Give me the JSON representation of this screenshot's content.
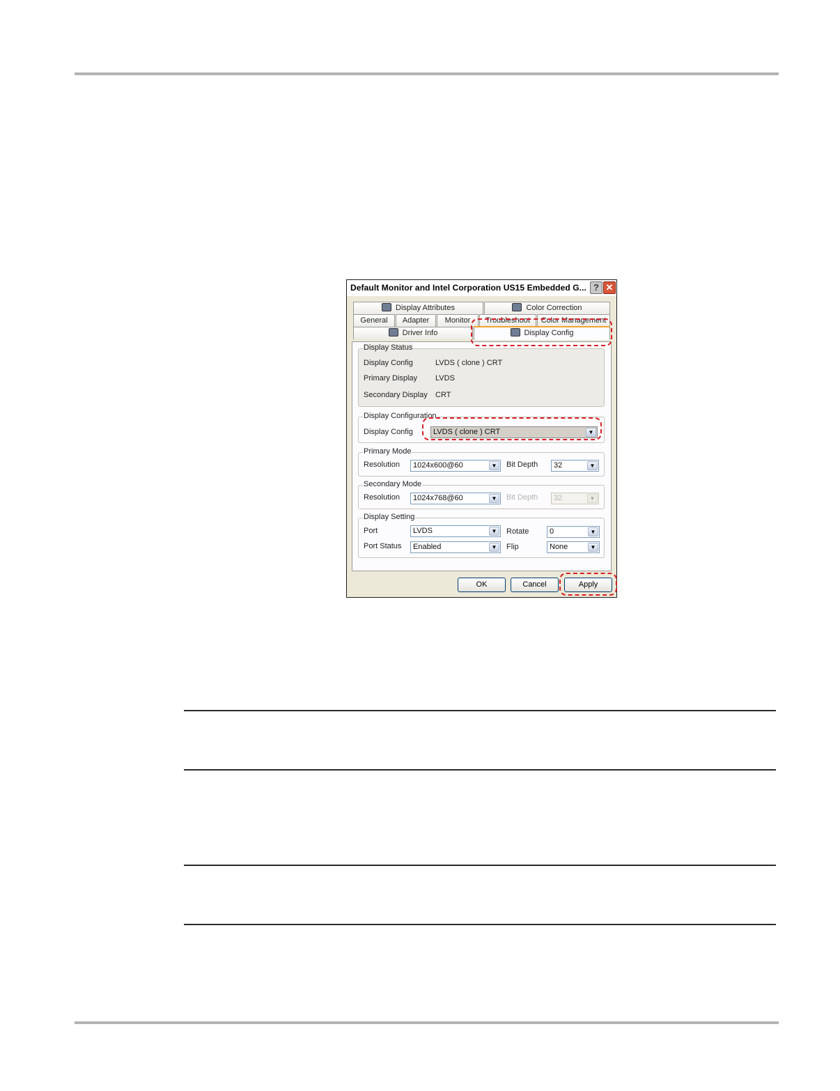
{
  "dialog": {
    "title": "Default Monitor and Intel Corporation US15 Embedded G...",
    "help_label": "?",
    "close_label": "✕",
    "tabs_row1": [
      "Display Attributes",
      "Color Correction"
    ],
    "tabs_row2": [
      "General",
      "Adapter",
      "Monitor",
      "Troubleshoot",
      "Color Management"
    ],
    "tabs_row3": [
      "Driver Info",
      "Display Config"
    ],
    "active_tab": "Display Config",
    "display_status": {
      "title": "Display Status",
      "config_label": "Display Config",
      "config_value": "LVDS ( clone ) CRT",
      "primary_label": "Primary Display",
      "primary_value": "LVDS",
      "secondary_label": "Secondary Display",
      "secondary_value": "CRT"
    },
    "display_configuration": {
      "title": "Display Configuration",
      "config_label": "Display Config",
      "config_value": "LVDS ( clone ) CRT"
    },
    "primary_mode": {
      "title": "Primary Mode",
      "resolution_label": "Resolution",
      "resolution_value": "1024x600@60",
      "bitdepth_label": "Bit Depth",
      "bitdepth_value": "32"
    },
    "secondary_mode": {
      "title": "Secondary Mode",
      "resolution_label": "Resolution",
      "resolution_value": "1024x768@60",
      "bitdepth_label": "Bit Depth",
      "bitdepth_value": "32"
    },
    "display_setting": {
      "title": "Display Setting",
      "port_label": "Port",
      "port_value": "LVDS",
      "port_status_label": "Port Status",
      "port_status_value": "Enabled",
      "rotate_label": "Rotate",
      "rotate_value": "0",
      "flip_label": "Flip",
      "flip_value": "None"
    },
    "buttons": {
      "ok": "OK",
      "cancel": "Cancel",
      "apply": "Apply"
    }
  },
  "colors": {
    "highlight": "#d81e26",
    "active_tab_accent": "#f3a22f",
    "dialog_face": "#ece9d8"
  },
  "icons": {
    "dropdown": "▼"
  }
}
